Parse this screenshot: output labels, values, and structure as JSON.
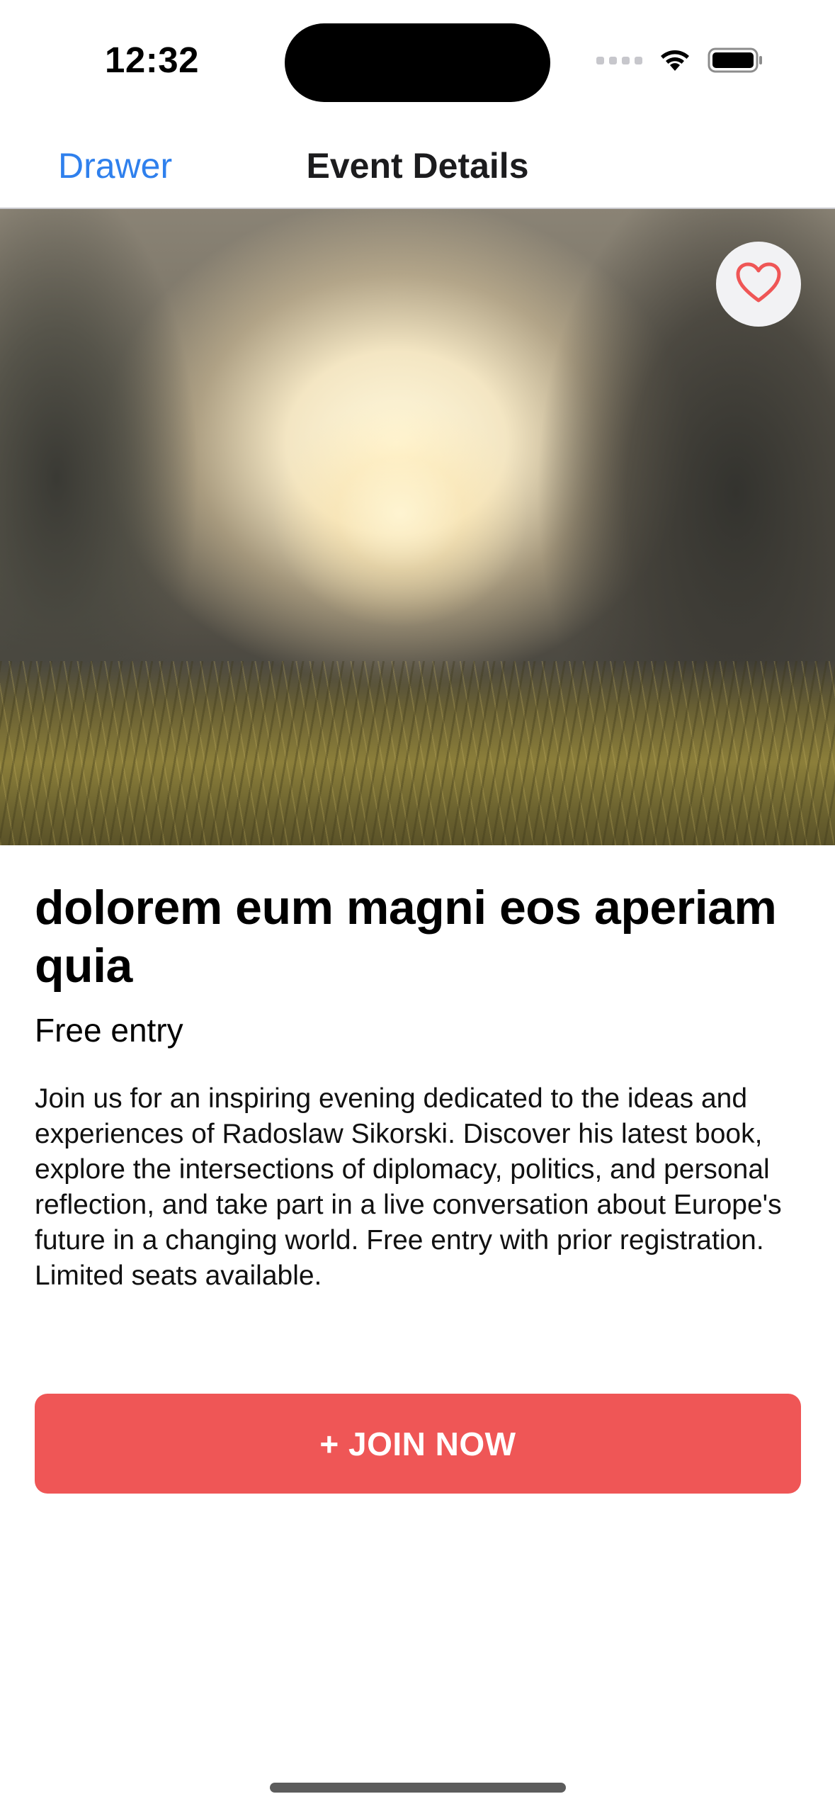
{
  "status_bar": {
    "time": "12:32",
    "icons": [
      "signal-icon",
      "wifi-icon",
      "battery-icon"
    ]
  },
  "nav": {
    "back_label": "Drawer",
    "title": "Event Details"
  },
  "hero": {
    "image_subject": "sunset over grass field",
    "favorite_icon": "heart-icon"
  },
  "event": {
    "title": "dolorem eum magni eos aperiam quia",
    "price": "Free entry",
    "description": "Join us for an inspiring evening dedicated to the ideas and experiences of Radoslaw Sikorski. Discover his latest book, explore the intersections of diplomacy, politics, and personal reflection, and take part in a live conversation about Europe's future in a changing world. Free entry with prior registration. Limited seats available."
  },
  "actions": {
    "join_label": "+ JOIN NOW"
  },
  "colors": {
    "accent_blue": "#2f80ed",
    "join_button": "#ef5656",
    "heart": "#ef5656"
  }
}
